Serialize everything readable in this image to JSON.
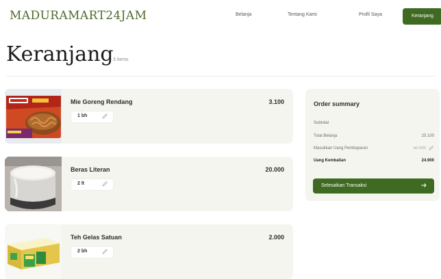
{
  "header": {
    "brand": "MADURAMART24JAM",
    "nav": [
      "Belanja",
      "Tentang Kami",
      "Profil Saya"
    ],
    "cta": "Keranjang"
  },
  "page": {
    "title": "Keranjang",
    "item_count": "3 items"
  },
  "cart": [
    {
      "name": "Mie Goreng Rendang",
      "price": "3.100",
      "qty": "1 bh",
      "image_icon": "noodle-pack-icon"
    },
    {
      "name": "Beras Literan",
      "price": "20.000",
      "qty": "2 lt",
      "image_icon": "rice-cup-icon"
    },
    {
      "name": "Teh Gelas Satuan",
      "price": "2.000",
      "qty": "2 bh",
      "image_icon": "tea-box-icon"
    }
  ],
  "summary": {
    "title": "Order summary",
    "subtitle": "Subtotal",
    "total_label": "Total Belanja",
    "total_value": "25.100",
    "payment_label": "Masukkan Uang Pembayaran",
    "payment_value": "50.000",
    "change_label": "Uang Kembalian",
    "change_value": "24.900",
    "button_label": "Selesaikan Transaksi"
  },
  "colors": {
    "accent": "#3f6a21",
    "brand_text": "#4e6b2c",
    "card_bg": "#f5f5f0"
  }
}
